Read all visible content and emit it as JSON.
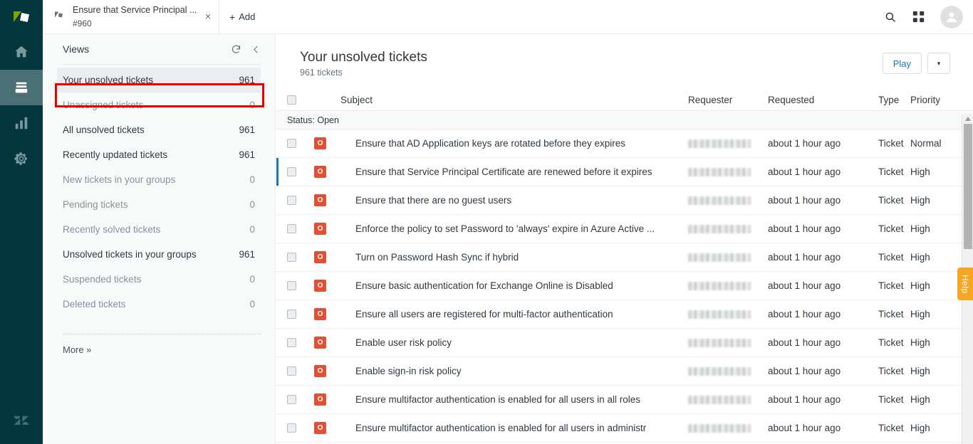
{
  "colors": {
    "rail_bg": "#03363d",
    "rail_active": "#4a7076",
    "accent_link": "#1f73b7",
    "status_open": "#e34f32",
    "help_tab": "#f5a623",
    "selection_outline": "#ee0000"
  },
  "rail": {
    "logo_name": "zendesk-logo",
    "items": [
      {
        "name": "home-icon",
        "label": "Home",
        "active": false
      },
      {
        "name": "views-icon",
        "label": "Views",
        "active": true
      },
      {
        "name": "reporting-icon",
        "label": "Reporting",
        "active": false
      },
      {
        "name": "admin-gear-icon",
        "label": "Admin",
        "active": false
      }
    ]
  },
  "topbar": {
    "tab": {
      "title": "Ensure that Service Principal ...",
      "subtitle": "#960",
      "close_label": "×"
    },
    "add_label": "Add",
    "add_plus": "+",
    "search_name": "search-icon",
    "apps_name": "apps-grid-icon",
    "avatar_name": "user-avatar"
  },
  "sidebar": {
    "title": "Views",
    "refresh_name": "refresh-icon",
    "collapse_name": "chevron-left-icon",
    "more_label": "More »",
    "items": [
      {
        "label": "Your unsolved tickets",
        "count": "961",
        "selected": true,
        "strong": true
      },
      {
        "label": "Unassigned tickets",
        "count": "0",
        "selected": false,
        "strong": false
      },
      {
        "label": "All unsolved tickets",
        "count": "961",
        "selected": false,
        "strong": true
      },
      {
        "label": "Recently updated tickets",
        "count": "961",
        "selected": false,
        "strong": true
      },
      {
        "label": "New tickets in your groups",
        "count": "0",
        "selected": false,
        "strong": false
      },
      {
        "label": "Pending tickets",
        "count": "0",
        "selected": false,
        "strong": false
      },
      {
        "label": "Recently solved tickets",
        "count": "0",
        "selected": false,
        "strong": false
      },
      {
        "label": "Unsolved tickets in your groups",
        "count": "961",
        "selected": false,
        "strong": true
      },
      {
        "label": "Suspended tickets",
        "count": "0",
        "selected": false,
        "strong": false
      },
      {
        "label": "Deleted tickets",
        "count": "0",
        "selected": false,
        "strong": false
      }
    ]
  },
  "main": {
    "title": "Your unsolved tickets",
    "subtitle": "961 tickets",
    "play_label": "Play",
    "caret_label": "▾",
    "columns": {
      "subject": "Subject",
      "requester": "Requester",
      "requested": "Requested",
      "type": "Type",
      "priority": "Priority"
    },
    "group_label": "Status: Open",
    "rows": [
      {
        "status": "O",
        "subject": "Ensure that AD Application keys are rotated before they expires",
        "requested": "about 1 hour ago",
        "type": "Ticket",
        "priority": "Normal",
        "current": false
      },
      {
        "status": "O",
        "subject": "Ensure that Service Principal Certificate are renewed before it expires",
        "requested": "about 1 hour ago",
        "type": "Ticket",
        "priority": "High",
        "current": true
      },
      {
        "status": "O",
        "subject": "Ensure that there are no guest users",
        "requested": "about 1 hour ago",
        "type": "Ticket",
        "priority": "High",
        "current": false
      },
      {
        "status": "O",
        "subject": "Enforce the policy to set Password to 'always' expire in Azure Active ...",
        "requested": "about 1 hour ago",
        "type": "Ticket",
        "priority": "High",
        "current": false
      },
      {
        "status": "O",
        "subject": "Turn on Password Hash Sync if hybrid",
        "requested": "about 1 hour ago",
        "type": "Ticket",
        "priority": "High",
        "current": false
      },
      {
        "status": "O",
        "subject": "Ensure basic authentication for Exchange Online is Disabled",
        "requested": "about 1 hour ago",
        "type": "Ticket",
        "priority": "High",
        "current": false
      },
      {
        "status": "O",
        "subject": "Ensure all users are registered for multi-factor authentication",
        "requested": "about 1 hour ago",
        "type": "Ticket",
        "priority": "High",
        "current": false
      },
      {
        "status": "O",
        "subject": "Enable user risk policy",
        "requested": "about 1 hour ago",
        "type": "Ticket",
        "priority": "High",
        "current": false
      },
      {
        "status": "O",
        "subject": "Enable sign-in risk policy",
        "requested": "about 1 hour ago",
        "type": "Ticket",
        "priority": "High",
        "current": false
      },
      {
        "status": "O",
        "subject": "Ensure multifactor authentication is enabled for all users in all roles",
        "requested": "about 1 hour ago",
        "type": "Ticket",
        "priority": "High",
        "current": false
      },
      {
        "status": "O",
        "subject": "Ensure multifactor authentication is enabled for all users in administr",
        "requested": "about 1 hour ago",
        "type": "Ticket",
        "priority": "High",
        "current": false
      }
    ]
  },
  "help": {
    "label": "Help"
  }
}
